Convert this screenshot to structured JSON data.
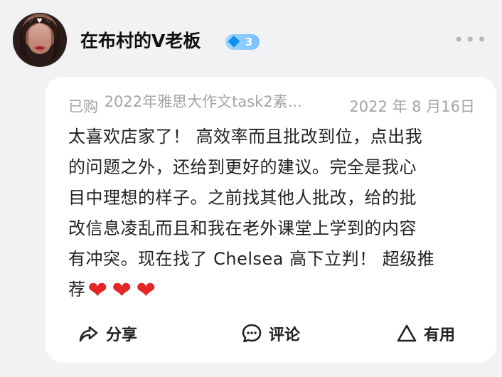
{
  "profile": {
    "username": "在布村的V老板",
    "level": "3",
    "avatar_decoration": "♡ ♥ ♡"
  },
  "review": {
    "purchase_status": "已购",
    "product": "2022年雅思大作文task2素...",
    "date": "2022 年 8 月16日",
    "content_lines": [
      "太喜欢店家了！ 高效率而且批改到位，点出我",
      "的问题之外，还给到更好的建议。完全是我心",
      "目中理想的样子。之前找其他人批改，给的批",
      "改信息凌乱而且和我在老外课堂上学到的内容",
      "有冲突。现在找了 Chelsea 高下立判！ 超级推",
      "荐"
    ],
    "heart_emojis": [
      "❤",
      "❤",
      "❤"
    ]
  },
  "actions": {
    "share": "分享",
    "comment": "评论",
    "useful": "有用"
  },
  "icons": {
    "more": "more-horizontal-icon",
    "level": "diamond-level-icon",
    "share": "share-icon",
    "comment": "comment-icon",
    "useful": "useful-icon"
  },
  "colors": {
    "background": "#f2f2f4",
    "card": "#ffffff",
    "meta_text": "#a3a3a8",
    "main_text": "#222222",
    "level_badge": "#8ccaff",
    "heart": "#e32626"
  }
}
